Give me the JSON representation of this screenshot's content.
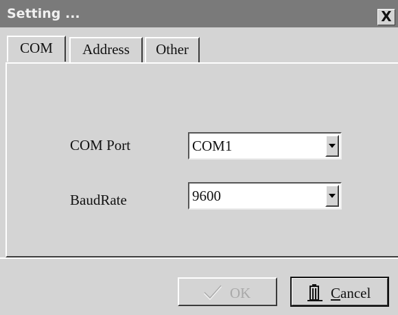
{
  "window": {
    "title": "Setting ...",
    "close_label": "X"
  },
  "tabs": [
    {
      "label": "COM",
      "active": true
    },
    {
      "label": "Address",
      "active": false
    },
    {
      "label": "Other",
      "active": false
    }
  ],
  "com": {
    "port_label": "COM Port",
    "port_value": "COM1",
    "baud_label": "BaudRate",
    "baud_value": "9600"
  },
  "buttons": {
    "ok_label": "OK",
    "ok_enabled": false,
    "cancel_label": "ancel",
    "cancel_mnemonic": "C"
  },
  "icons": {
    "ok": "checkmark-icon",
    "cancel": "door-exit-icon",
    "dropdown": "chevron-down-icon",
    "close": "close-icon"
  }
}
